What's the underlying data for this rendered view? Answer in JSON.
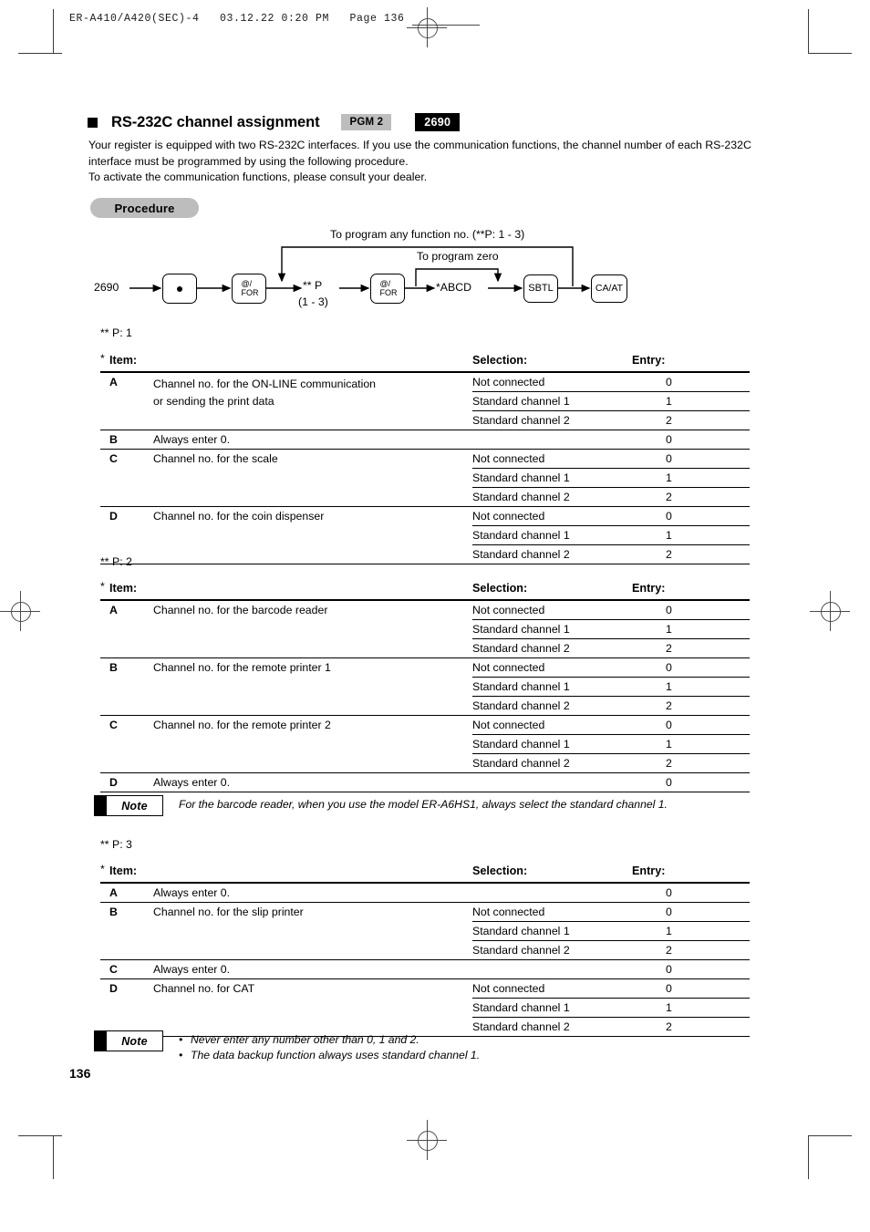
{
  "file_header": "ER-A410/A420(SEC)-4   03.12.22 0:20 PM   Page 136",
  "section": {
    "title": "RS-232C channel assignment",
    "badge_mode": "PGM 2",
    "badge_code": "2690",
    "intro": "Your register is equipped with two RS-232C interfaces. If you use the communication functions, the channel number of each RS-232C interface must be programmed by using the following procedure.\nTo activate the communication functions, please consult your dealer."
  },
  "procedure": {
    "pill_label": "Procedure",
    "loop_top_label": "To program any function no. (**P: 1 - 3)",
    "loop_mid_label": "To program zero",
    "start_value": "2690",
    "key_dot": "•",
    "key_atfor_top": "@/",
    "key_atfor_bottom": "FOR",
    "node_p": "** P",
    "node_p_range": "(1 - 3)",
    "node_abcd": "*ABCD",
    "key_sbtl": "SBTL",
    "key_caat": "CA/AT"
  },
  "tables": [
    {
      "p_label": "** P: 1",
      "asterisk": "*",
      "headers": {
        "item": "Item:",
        "selection": "Selection:",
        "entry": "Entry:"
      },
      "rows": [
        {
          "letter": "A",
          "desc": "Channel no. for the ON-LINE communication\nor sending the print data",
          "options": [
            {
              "selection": "Not connected",
              "entry": "0"
            },
            {
              "selection": "Standard channel 1",
              "entry": "1"
            },
            {
              "selection": "Standard channel 2",
              "entry": "2"
            }
          ]
        },
        {
          "letter": "B",
          "desc": "Always enter 0.",
          "options": [
            {
              "selection": "",
              "entry": "0"
            }
          ]
        },
        {
          "letter": "C",
          "desc": "Channel no. for the scale",
          "options": [
            {
              "selection": "Not connected",
              "entry": "0"
            },
            {
              "selection": "Standard channel 1",
              "entry": "1"
            },
            {
              "selection": "Standard channel 2",
              "entry": "2"
            }
          ]
        },
        {
          "letter": "D",
          "desc": "Channel no. for the coin dispenser",
          "options": [
            {
              "selection": "Not connected",
              "entry": "0"
            },
            {
              "selection": "Standard channel 1",
              "entry": "1"
            },
            {
              "selection": "Standard channel 2",
              "entry": "2"
            }
          ]
        }
      ]
    },
    {
      "p_label": "** P: 2",
      "asterisk": "*",
      "headers": {
        "item": "Item:",
        "selection": "Selection:",
        "entry": "Entry:"
      },
      "rows": [
        {
          "letter": "A",
          "desc": "Channel no. for the barcode reader",
          "options": [
            {
              "selection": "Not connected",
              "entry": "0"
            },
            {
              "selection": "Standard channel 1",
              "entry": "1"
            },
            {
              "selection": "Standard channel 2",
              "entry": "2"
            }
          ]
        },
        {
          "letter": "B",
          "desc": "Channel no. for the remote printer 1",
          "options": [
            {
              "selection": "Not connected",
              "entry": "0"
            },
            {
              "selection": "Standard channel 1",
              "entry": "1"
            },
            {
              "selection": "Standard channel 2",
              "entry": "2"
            }
          ]
        },
        {
          "letter": "C",
          "desc": "Channel no. for the remote printer 2",
          "options": [
            {
              "selection": "Not connected",
              "entry": "0"
            },
            {
              "selection": "Standard channel 1",
              "entry": "1"
            },
            {
              "selection": "Standard channel 2",
              "entry": "2"
            }
          ]
        },
        {
          "letter": "D",
          "desc": "Always enter 0.",
          "options": [
            {
              "selection": "",
              "entry": "0"
            }
          ]
        }
      ]
    },
    {
      "p_label": "** P: 3",
      "asterisk": "*",
      "headers": {
        "item": "Item:",
        "selection": "Selection:",
        "entry": "Entry:"
      },
      "rows": [
        {
          "letter": "A",
          "desc": "Always enter 0.",
          "options": [
            {
              "selection": "",
              "entry": "0"
            }
          ]
        },
        {
          "letter": "B",
          "desc": "Channel no. for the slip printer",
          "options": [
            {
              "selection": "Not connected",
              "entry": "0"
            },
            {
              "selection": "Standard channel 1",
              "entry": "1"
            },
            {
              "selection": "Standard channel 2",
              "entry": "2"
            }
          ]
        },
        {
          "letter": "C",
          "desc": "Always enter 0.",
          "options": [
            {
              "selection": "",
              "entry": "0"
            }
          ]
        },
        {
          "letter": "D",
          "desc": "Channel no. for CAT",
          "options": [
            {
              "selection": "Not connected",
              "entry": "0"
            },
            {
              "selection": "Standard channel 1",
              "entry": "1"
            },
            {
              "selection": "Standard channel 2",
              "entry": "2"
            }
          ]
        }
      ]
    }
  ],
  "notes": [
    {
      "label": "Note",
      "lines": [
        "For the barcode reader, when you use the model ER-A6HS1, always select the standard channel 1."
      ],
      "bulleted": false
    },
    {
      "label": "Note",
      "lines": [
        "Never enter any number other than 0, 1 and 2.",
        "The data backup function always uses standard channel 1."
      ],
      "bulleted": true,
      "bullet_glyph": "•"
    }
  ],
  "page_number": "136"
}
